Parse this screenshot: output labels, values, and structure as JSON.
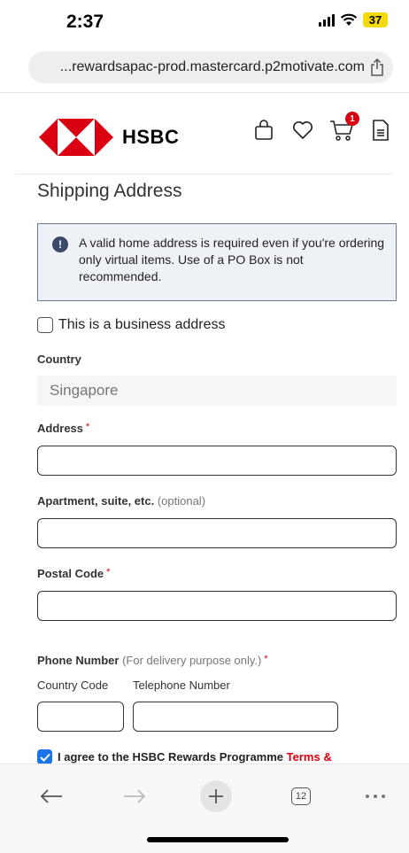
{
  "status_bar": {
    "time": "2:37",
    "battery": "37"
  },
  "browser": {
    "url": "...rewardsapac-prod.mastercard.p2motivate.com",
    "tab_count": "12"
  },
  "header": {
    "logo_text": "HSBC",
    "cart_count": "1"
  },
  "form": {
    "title": "Shipping Address",
    "notice": "A valid home address is required even if you're ordering only virtual items. Use of a PO Box is not recommended.",
    "business_checkbox_label": "This is a business address",
    "country_label": "Country",
    "country_value": "Singapore",
    "address_label": "Address",
    "apartment_label": "Apartment, suite, etc.",
    "apartment_optional": "(optional)",
    "postal_label": "Postal Code",
    "phone_label": "Phone Number",
    "phone_note": "(For delivery purpose only.)",
    "country_code_label": "Country Code",
    "telephone_label": "Telephone Number",
    "required_mark": "*",
    "agree_text": "I agree to the HSBC Rewards Programme",
    "terms_link": "Terms &"
  },
  "colors": {
    "brand_red": "#db0011",
    "checkbox_blue": "#1a73e8"
  }
}
